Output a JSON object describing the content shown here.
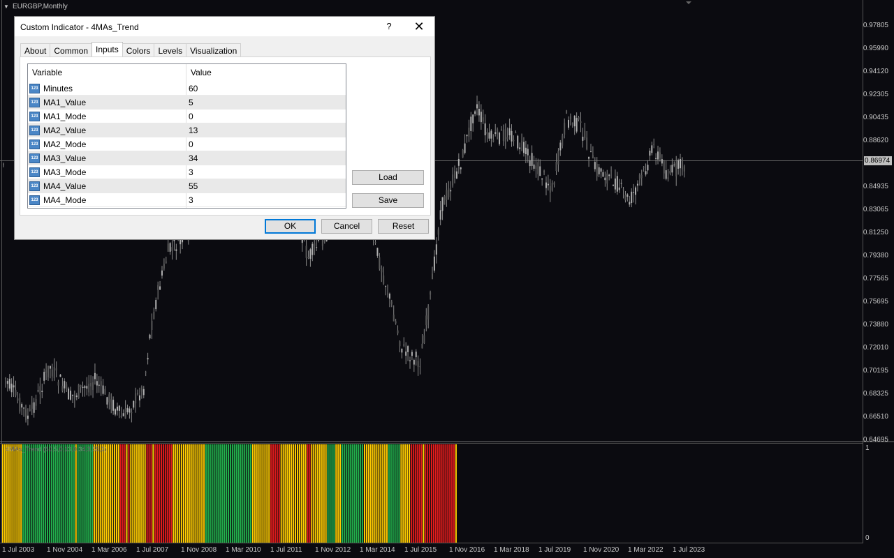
{
  "chart": {
    "symbol_label": "EURGBP,Monthly",
    "price_axis": [
      "0.97805",
      "0.95990",
      "0.94120",
      "0.92305",
      "0.90435",
      "0.88620",
      "0.84935",
      "0.83065",
      "0.81250",
      "0.79380",
      "0.77565",
      "0.75695",
      "0.73880",
      "0.72010",
      "0.70195",
      "0.68325",
      "0.66510",
      "0.64695"
    ],
    "current_price": "0.86974",
    "time_axis": [
      "1 Jul 2003",
      "1 Nov 2004",
      "1 Mar 2006",
      "1 Jul 2007",
      "1 Nov 2008",
      "1 Mar 2010",
      "1 Jul 2011",
      "1 Nov 2012",
      "1 Mar 2014",
      "1 Jul 2015",
      "1 Nov 2016",
      "1 Mar 2018",
      "1 Jul 2019",
      "1 Nov 2020",
      "1 Mar 2022",
      "1 Jul 2023"
    ],
    "indicator_label": "4MAs_Trend (60,5,0,13,0,34,3,55,3)",
    "indicator_max": "1",
    "indicator_min": "0",
    "colors": {
      "background": "#0b0b10",
      "candle": "#8a8a8a",
      "green": "#22b14c",
      "red": "#e31b1b",
      "yellow": "#ffcc00",
      "separator": "#000000"
    },
    "trend_segments": [
      {
        "state": "yellow",
        "bars": 10
      },
      {
        "state": "green",
        "bars": 26
      },
      {
        "state": "yellow",
        "bars": 1
      },
      {
        "state": "green",
        "bars": 8
      },
      {
        "state": "yellow",
        "bars": 13
      },
      {
        "state": "red",
        "bars": 3
      },
      {
        "state": "yellow",
        "bars": 1
      },
      {
        "state": "red",
        "bars": 1
      },
      {
        "state": "yellow",
        "bars": 8
      },
      {
        "state": "red",
        "bars": 3
      },
      {
        "state": "yellow",
        "bars": 1
      },
      {
        "state": "red",
        "bars": 9
      },
      {
        "state": "yellow",
        "bars": 16
      },
      {
        "state": "green",
        "bars": 23
      },
      {
        "state": "yellow",
        "bars": 9
      },
      {
        "state": "red",
        "bars": 5
      },
      {
        "state": "yellow",
        "bars": 13
      },
      {
        "state": "red",
        "bars": 2
      },
      {
        "state": "yellow",
        "bars": 8
      },
      {
        "state": "green",
        "bars": 4
      },
      {
        "state": "yellow",
        "bars": 3
      },
      {
        "state": "green",
        "bars": 11
      },
      {
        "state": "yellow",
        "bars": 12
      },
      {
        "state": "green",
        "bars": 6
      },
      {
        "state": "yellow",
        "bars": 5
      },
      {
        "state": "red",
        "bars": 6
      },
      {
        "state": "yellow",
        "bars": 1
      },
      {
        "state": "red",
        "bars": 15
      },
      {
        "state": "yellow",
        "bars": 1
      }
    ]
  },
  "dialog": {
    "title": "Custom Indicator - 4MAs_Trend",
    "help_label": "?",
    "close_label": "✕",
    "tabs": [
      "About",
      "Common",
      "Inputs",
      "Colors",
      "Levels",
      "Visualization"
    ],
    "active_tab": "Inputs",
    "columns": [
      "Variable",
      "Value"
    ],
    "icon_glyph": "123",
    "rows": [
      {
        "name": "Minutes",
        "value": "60"
      },
      {
        "name": "MA1_Value",
        "value": "5"
      },
      {
        "name": "MA1_Mode",
        "value": "0"
      },
      {
        "name": "MA2_Value",
        "value": "13"
      },
      {
        "name": "MA2_Mode",
        "value": "0"
      },
      {
        "name": "MA3_Value",
        "value": "34"
      },
      {
        "name": "MA3_Mode",
        "value": "3"
      },
      {
        "name": "MA4_Value",
        "value": "55"
      },
      {
        "name": "MA4_Mode",
        "value": "3"
      }
    ],
    "load_label": "Load",
    "save_label": "Save",
    "ok_label": "OK",
    "cancel_label": "Cancel",
    "reset_label": "Reset"
  }
}
